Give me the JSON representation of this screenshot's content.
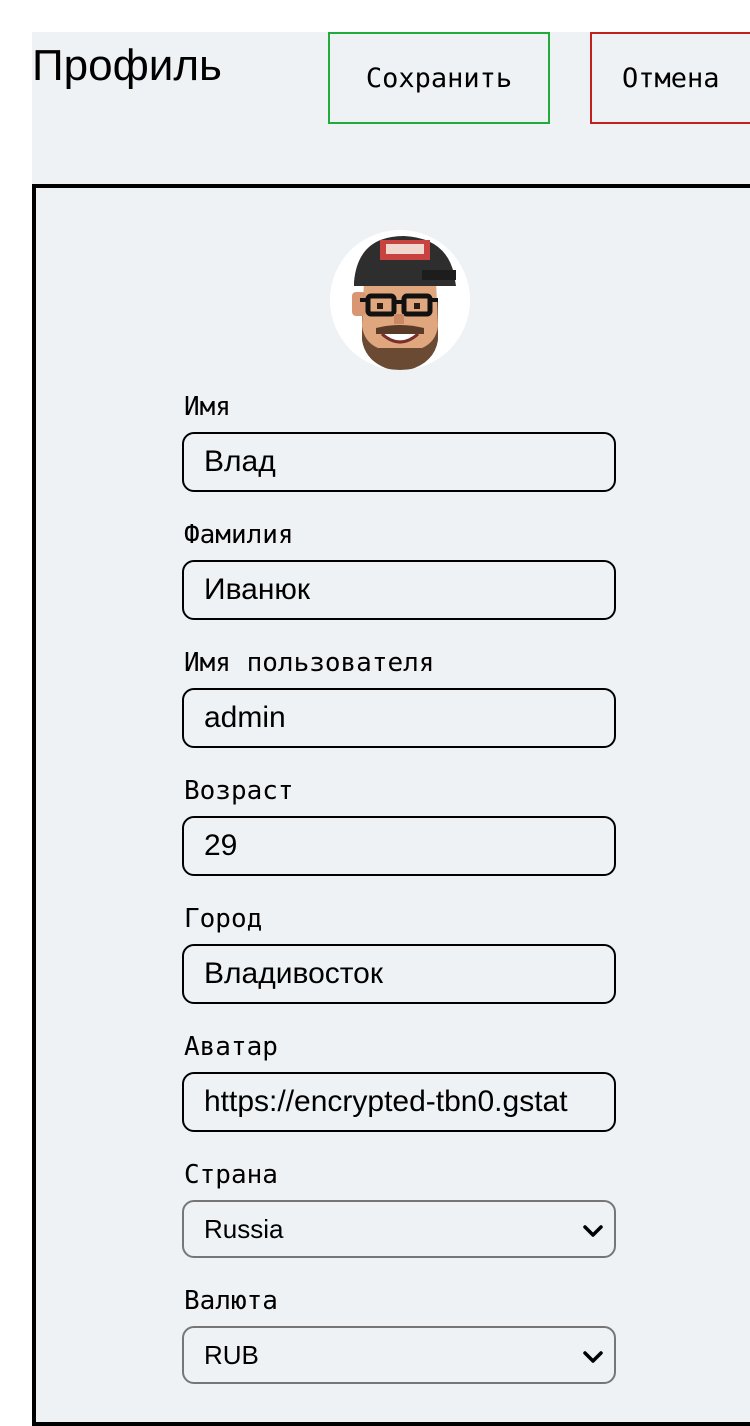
{
  "header": {
    "title": "Профиль",
    "save_label": "Сохранить",
    "cancel_label": "Отмена"
  },
  "colors": {
    "background": "#eef2f5",
    "save_border": "#22aa3a",
    "cancel_border": "#c0211f"
  },
  "avatar": {
    "icon": "user-avatar-image"
  },
  "form": {
    "first_name": {
      "label": "Имя",
      "value": "Влад"
    },
    "last_name": {
      "label": "Фамилия",
      "value": "Иванюк"
    },
    "username": {
      "label": "Имя пользователя",
      "value": "admin"
    },
    "age": {
      "label": "Возраст",
      "value": "29"
    },
    "city": {
      "label": "Город",
      "value": "Владивосток"
    },
    "avatar_url": {
      "label": "Аватар",
      "value": "https://encrypted-tbn0.gstat"
    },
    "country": {
      "label": "Страна",
      "selected": "Russia"
    },
    "currency": {
      "label": "Валюта",
      "selected": "RUB"
    }
  }
}
